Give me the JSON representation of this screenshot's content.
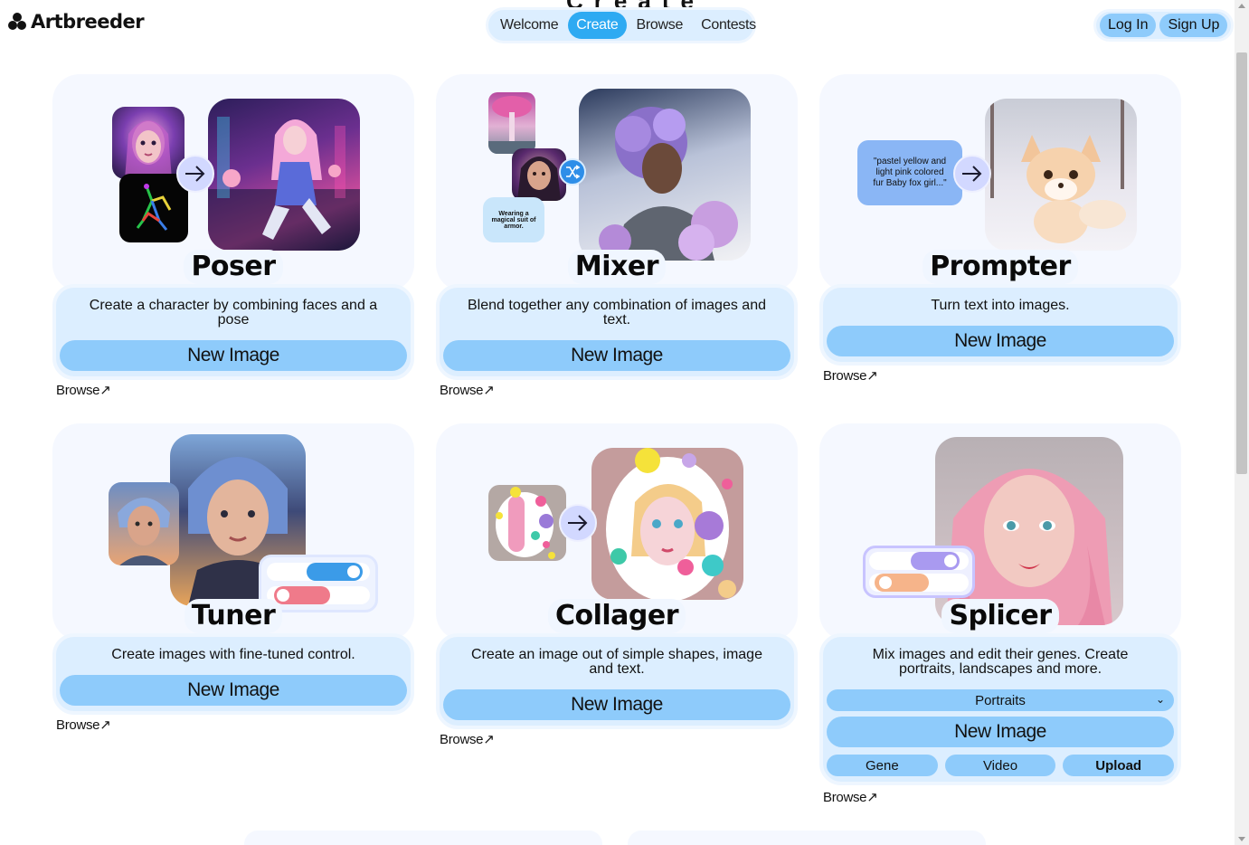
{
  "app": {
    "logo_text": "Artbreeder",
    "ghost_heading": "Create"
  },
  "nav": {
    "tabs": [
      {
        "label": "Welcome"
      },
      {
        "label": "Create",
        "active": true
      },
      {
        "label": "Browse"
      },
      {
        "label": "Contests"
      }
    ]
  },
  "auth": {
    "login_label": "Log In",
    "signup_label": "Sign Up"
  },
  "colors": {
    "accent": "#2eaaf2",
    "button": "#8ecbfb",
    "panel": "#dceeff",
    "art_bg": "#f5f8ff"
  },
  "cards": [
    {
      "title": "Poser",
      "description": "Create a character by combining faces and a pose",
      "button": "New Image",
      "browse": "Browse↗"
    },
    {
      "title": "Mixer",
      "description": "Blend together any combination of images and text.",
      "button": "New Image",
      "browse": "Browse↗",
      "art_text": "Wearing a magical suit of armor."
    },
    {
      "title": "Prompter",
      "description": "Turn text into images.",
      "button": "New Image",
      "browse": "Browse↗",
      "art_text": "\"pastel yellow and light pink colored fur Baby fox girl...\""
    },
    {
      "title": "Tuner",
      "description": "Create images with fine-tuned control.",
      "button": "New Image",
      "browse": "Browse↗"
    },
    {
      "title": "Collager",
      "description": "Create an image out of simple shapes, image and text.",
      "button": "New Image",
      "browse": "Browse↗"
    },
    {
      "title": "Splicer",
      "description": "Mix images and edit their genes. Create portraits, landscapes and more.",
      "button": "New Image",
      "browse": "Browse↗",
      "select_value": "Portraits",
      "gene_label": "Gene",
      "video_label": "Video",
      "upload_label": "Upload"
    }
  ],
  "icons": {
    "arrow": "arrow-right-icon",
    "shuffle": "shuffle-icon",
    "chevron": "chevron-down-icon",
    "external": "external-link-icon"
  }
}
